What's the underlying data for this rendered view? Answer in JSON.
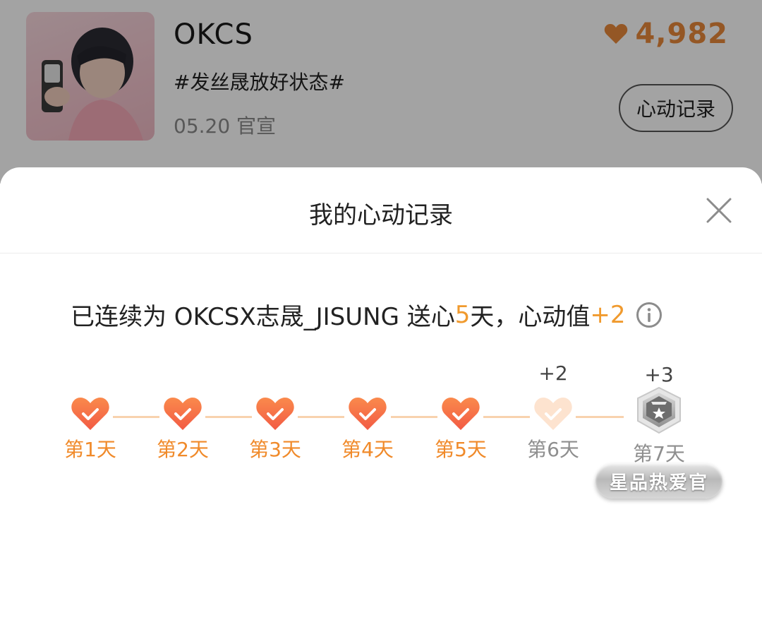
{
  "post": {
    "title": "OKCS",
    "tag": "#发丝晟放好状态#",
    "date": "05.20 官宣",
    "likes": "4,982",
    "record_button": "心动记录"
  },
  "sheet": {
    "title": "我的心动记录",
    "summary": {
      "prefix": "已连续为 OKCSX志晟_JISUNG 送心",
      "days": "5",
      "mid": "天，心动值",
      "bonus": "+2"
    }
  },
  "days": [
    {
      "label": "第1天",
      "done": true
    },
    {
      "label": "第2天",
      "done": true
    },
    {
      "label": "第3天",
      "done": true
    },
    {
      "label": "第4天",
      "done": true
    },
    {
      "label": "第5天",
      "done": true
    },
    {
      "label": "第6天",
      "done": false,
      "bonus": "+2"
    },
    {
      "label": "第7天",
      "done": false,
      "bonus": "+3"
    }
  ],
  "badge_pill": "星品热爱官",
  "colors": {
    "accent": "#f09a2e",
    "heart_active": "#f26b45",
    "heart_inactive": "#fde3cf",
    "connector": "#f8d2ae"
  },
  "icons": [
    "heart-icon",
    "close-icon",
    "info-icon",
    "check-heart-icon",
    "medal-badge-icon"
  ]
}
